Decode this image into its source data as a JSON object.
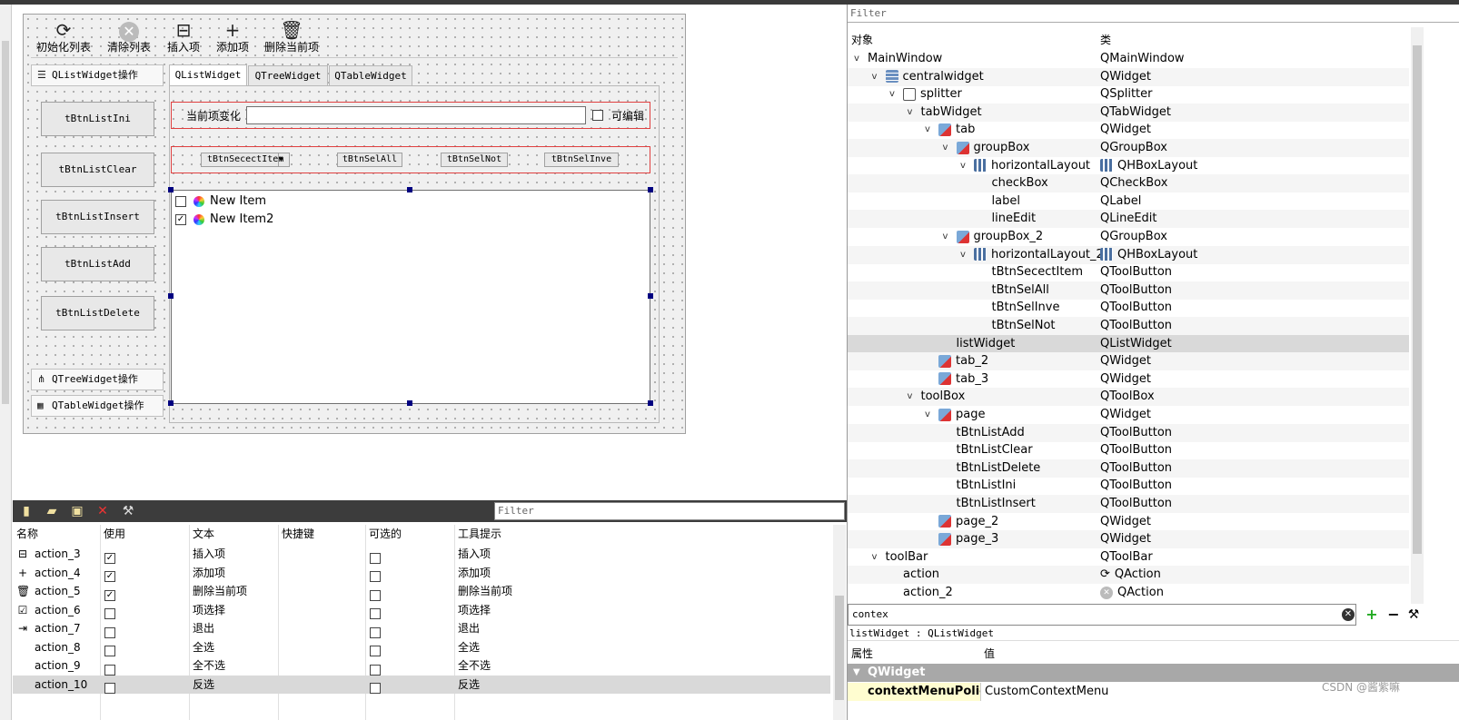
{
  "toolbar": {
    "items": [
      {
        "label": "初始化列表",
        "icon": "refresh-icon"
      },
      {
        "label": "清除列表",
        "icon": "clear-icon"
      },
      {
        "label": "插入项",
        "icon": "insert-icon"
      },
      {
        "label": "添加项",
        "icon": "plus-icon"
      },
      {
        "label": "删除当前项",
        "icon": "trash-icon"
      }
    ]
  },
  "toolbox": {
    "pages": [
      "QListWidget操作",
      "QTreeWidget操作",
      "QTableWidget操作"
    ],
    "buttons": [
      "tBtnListIni",
      "tBtnListClear",
      "tBtnListInsert",
      "tBtnListAdd",
      "tBtnListDelete"
    ]
  },
  "tabs": [
    "QListWidget",
    "QTreeWidget",
    "QTableWidget"
  ],
  "group1": {
    "label": "当前项变化",
    "checkbox_label": "可编辑",
    "line_value": ""
  },
  "group2": {
    "buttons": [
      "tBtnSecectItem",
      "tBtnSelAll",
      "tBtnSelNot",
      "tBtnSelInve"
    ]
  },
  "list_items": [
    {
      "text": "New Item",
      "checked": false
    },
    {
      "text": "New Item2",
      "checked": true
    }
  ],
  "actions": {
    "filter_placeholder": "Filter",
    "headers": [
      "名称",
      "使用",
      "文本",
      "快捷键",
      "可选的",
      "工具提示"
    ],
    "rows": [
      {
        "name": "action_3",
        "used": true,
        "text": "插入项",
        "tooltip": "插入项",
        "icon": "insert-icon"
      },
      {
        "name": "action_4",
        "used": true,
        "text": "添加项",
        "tooltip": "添加项",
        "icon": "plus-icon"
      },
      {
        "name": "action_5",
        "used": true,
        "text": "删除当前项",
        "tooltip": "删除当前项",
        "icon": "trash-icon"
      },
      {
        "name": "action_6",
        "used": false,
        "text": "项选择",
        "tooltip": "项选择",
        "icon": "check-icon"
      },
      {
        "name": "action_7",
        "used": false,
        "text": "退出",
        "tooltip": "退出",
        "icon": "exit-icon"
      },
      {
        "name": "action_8",
        "used": false,
        "text": "全选",
        "tooltip": "全选",
        "icon": "blank-icon"
      },
      {
        "name": "action_9",
        "used": false,
        "text": "全不选",
        "tooltip": "全不选",
        "icon": "blank-icon"
      },
      {
        "name": "action_10",
        "used": false,
        "text": "反选",
        "tooltip": "反选",
        "icon": "blank-icon"
      }
    ]
  },
  "objects": {
    "filter_placeholder": "Filter",
    "headers": [
      "对象",
      "类"
    ],
    "rows": [
      {
        "name": "MainWindow",
        "cls": "QMainWindow",
        "depth": 0,
        "arrow": "v",
        "icon": ""
      },
      {
        "name": "centralwidget",
        "cls": "QWidget",
        "depth": 1,
        "arrow": "v",
        "icon": "cw"
      },
      {
        "name": "splitter",
        "cls": "QSplitter",
        "depth": 2,
        "arrow": "v",
        "icon": "sp"
      },
      {
        "name": "tabWidget",
        "cls": "QTabWidget",
        "depth": 3,
        "arrow": "v",
        "icon": ""
      },
      {
        "name": "tab",
        "cls": "QWidget",
        "depth": 4,
        "arrow": "v",
        "icon": "w"
      },
      {
        "name": "groupBox",
        "cls": "QGroupBox",
        "depth": 5,
        "arrow": "v",
        "icon": "w"
      },
      {
        "name": "horizontalLayout",
        "cls": "QHBoxLayout",
        "depth": 6,
        "arrow": "v",
        "icon": "lay",
        "clsicon": "lay"
      },
      {
        "name": "checkBox",
        "cls": "QCheckBox",
        "depth": 7,
        "arrow": "",
        "icon": ""
      },
      {
        "name": "label",
        "cls": "QLabel",
        "depth": 7,
        "arrow": "",
        "icon": ""
      },
      {
        "name": "lineEdit",
        "cls": "QLineEdit",
        "depth": 7,
        "arrow": "",
        "icon": ""
      },
      {
        "name": "groupBox_2",
        "cls": "QGroupBox",
        "depth": 5,
        "arrow": "v",
        "icon": "w"
      },
      {
        "name": "horizontalLayout_2",
        "cls": "QHBoxLayout",
        "depth": 6,
        "arrow": "v",
        "icon": "lay",
        "clsicon": "lay"
      },
      {
        "name": "tBtnSecectItem",
        "cls": "QToolButton",
        "depth": 7,
        "arrow": "",
        "icon": ""
      },
      {
        "name": "tBtnSelAll",
        "cls": "QToolButton",
        "depth": 7,
        "arrow": "",
        "icon": ""
      },
      {
        "name": "tBtnSelInve",
        "cls": "QToolButton",
        "depth": 7,
        "arrow": "",
        "icon": ""
      },
      {
        "name": "tBtnSelNot",
        "cls": "QToolButton",
        "depth": 7,
        "arrow": "",
        "icon": ""
      },
      {
        "name": "listWidget",
        "cls": "QListWidget",
        "depth": 5,
        "arrow": "",
        "icon": "",
        "selected": true
      },
      {
        "name": "tab_2",
        "cls": "QWidget",
        "depth": 4,
        "arrow": "",
        "icon": "w"
      },
      {
        "name": "tab_3",
        "cls": "QWidget",
        "depth": 4,
        "arrow": "",
        "icon": "w"
      },
      {
        "name": "toolBox",
        "cls": "QToolBox",
        "depth": 3,
        "arrow": "v",
        "icon": ""
      },
      {
        "name": "page",
        "cls": "QWidget",
        "depth": 4,
        "arrow": "v",
        "icon": "w"
      },
      {
        "name": "tBtnListAdd",
        "cls": "QToolButton",
        "depth": 5,
        "arrow": "",
        "icon": ""
      },
      {
        "name": "tBtnListClear",
        "cls": "QToolButton",
        "depth": 5,
        "arrow": "",
        "icon": ""
      },
      {
        "name": "tBtnListDelete",
        "cls": "QToolButton",
        "depth": 5,
        "arrow": "",
        "icon": ""
      },
      {
        "name": "tBtnListIni",
        "cls": "QToolButton",
        "depth": 5,
        "arrow": "",
        "icon": ""
      },
      {
        "name": "tBtnListInsert",
        "cls": "QToolButton",
        "depth": 5,
        "arrow": "",
        "icon": ""
      },
      {
        "name": "page_2",
        "cls": "QWidget",
        "depth": 4,
        "arrow": "",
        "icon": "w"
      },
      {
        "name": "page_3",
        "cls": "QWidget",
        "depth": 4,
        "arrow": "",
        "icon": "w"
      },
      {
        "name": "toolBar",
        "cls": "QToolBar",
        "depth": 1,
        "arrow": "v",
        "icon": ""
      },
      {
        "name": "action",
        "cls": "QAction",
        "depth": 2,
        "arrow": "",
        "icon": "",
        "clsicon": "refresh"
      },
      {
        "name": "action_2",
        "cls": "QAction",
        "depth": 2,
        "arrow": "",
        "icon": "",
        "clsicon": "clear"
      }
    ]
  },
  "properties": {
    "filter_value": "contex",
    "object_label": "listWidget : QListWidget",
    "headers": [
      "属性",
      "值"
    ],
    "group": "QWidget",
    "row": {
      "name": "contextMenuPolicy",
      "value": "CustomContextMenu"
    }
  },
  "watermark": "CSDN @酱紫嘛"
}
